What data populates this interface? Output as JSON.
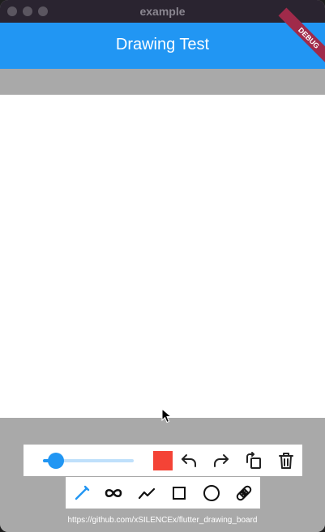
{
  "window": {
    "title": "example"
  },
  "appbar": {
    "title": "Drawing Test",
    "debug_banner": "DEBUG"
  },
  "toolbar": {
    "stroke_width_fraction": 0.14,
    "color": "#f44336",
    "actions": [
      "undo-icon",
      "redo-icon",
      "rotate-icon",
      "delete-icon"
    ]
  },
  "tools": [
    "pen-icon",
    "infinity-icon",
    "polyline-icon",
    "square-icon",
    "circle-icon",
    "eraser-icon"
  ],
  "colors": {
    "accent": "#2196f3",
    "selected_tool": "#2196f3"
  },
  "footer": {
    "url": "https://github.com/xSILENCEx/flutter_drawing_board"
  }
}
